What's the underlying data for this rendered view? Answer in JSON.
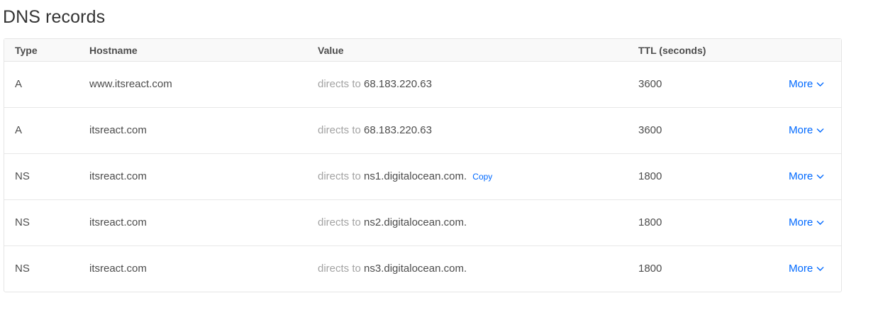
{
  "page": {
    "title": "DNS records"
  },
  "table": {
    "headers": {
      "type": "Type",
      "hostname": "Hostname",
      "value": "Value",
      "ttl": "TTL (seconds)"
    },
    "rows": [
      {
        "type": "A",
        "hostname": "www.itsreact.com",
        "value_prefix": "directs to",
        "value": "68.183.220.63",
        "copy_label": "",
        "ttl": "3600",
        "more_label": "More"
      },
      {
        "type": "A",
        "hostname": "itsreact.com",
        "value_prefix": "directs to",
        "value": "68.183.220.63",
        "copy_label": "",
        "ttl": "3600",
        "more_label": "More"
      },
      {
        "type": "NS",
        "hostname": "itsreact.com",
        "value_prefix": "directs to",
        "value": "ns1.digitalocean.com.",
        "copy_label": "Copy",
        "ttl": "1800",
        "more_label": "More"
      },
      {
        "type": "NS",
        "hostname": "itsreact.com",
        "value_prefix": "directs to",
        "value": "ns2.digitalocean.com.",
        "copy_label": "",
        "ttl": "1800",
        "more_label": "More"
      },
      {
        "type": "NS",
        "hostname": "itsreact.com",
        "value_prefix": "directs to",
        "value": "ns3.digitalocean.com.",
        "copy_label": "",
        "ttl": "1800",
        "more_label": "More"
      }
    ]
  },
  "icons": {
    "more_chevron": "chevron-down-icon"
  },
  "colors": {
    "link": "#0069ff",
    "muted_text": "#a3a3a3",
    "body_text": "#4d4d4d",
    "border": "#e5e5e5",
    "header_bg": "#f9f9f9"
  }
}
